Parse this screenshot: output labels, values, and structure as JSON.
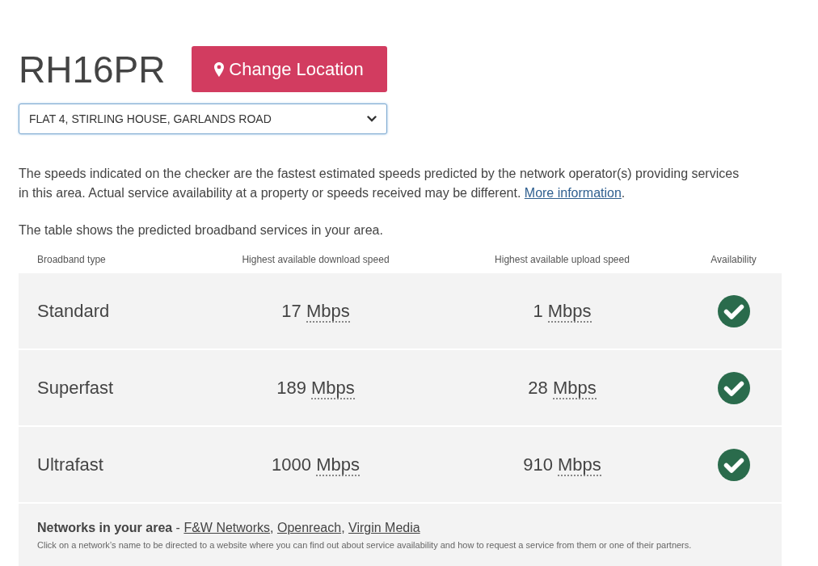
{
  "location": {
    "postcode": "RH16PR",
    "change_button": "Change Location",
    "address_select": {
      "value": "FLAT 4, STIRLING HOUSE, GARLANDS ROAD"
    }
  },
  "disclaimer": {
    "text": "The speeds indicated on the checker are the fastest estimated speeds predicted by the network operator(s) providing services in this area. Actual service availability at a property or speeds received may be different.",
    "link": "More information",
    "after_link": "."
  },
  "table_intro": "The table shows the predicted broadband services in your area.",
  "table": {
    "columns": [
      "Broadband type",
      "Highest available download speed",
      "Highest available upload speed",
      "Availability"
    ],
    "rows": [
      {
        "type": "Standard",
        "download": {
          "value": "17",
          "unit": "Mbps"
        },
        "upload": {
          "value": "1",
          "unit": "Mbps"
        },
        "available": true
      },
      {
        "type": "Superfast",
        "download": {
          "value": "189",
          "unit": "Mbps"
        },
        "upload": {
          "value": "28",
          "unit": "Mbps"
        },
        "available": true
      },
      {
        "type": "Ultrafast",
        "download": {
          "value": "1000",
          "unit": "Mbps"
        },
        "upload": {
          "value": "910",
          "unit": "Mbps"
        },
        "available": true
      }
    ]
  },
  "networks": {
    "heading": "Networks in your area",
    "separator": "-",
    "links": [
      "F&W Networks",
      "Openreach",
      "Virgin Media"
    ],
    "link_separator": ",",
    "note": "Click on a network’s name to be directed to a website where you can find out about service availability and how to request a service from them or one of their partners."
  }
}
